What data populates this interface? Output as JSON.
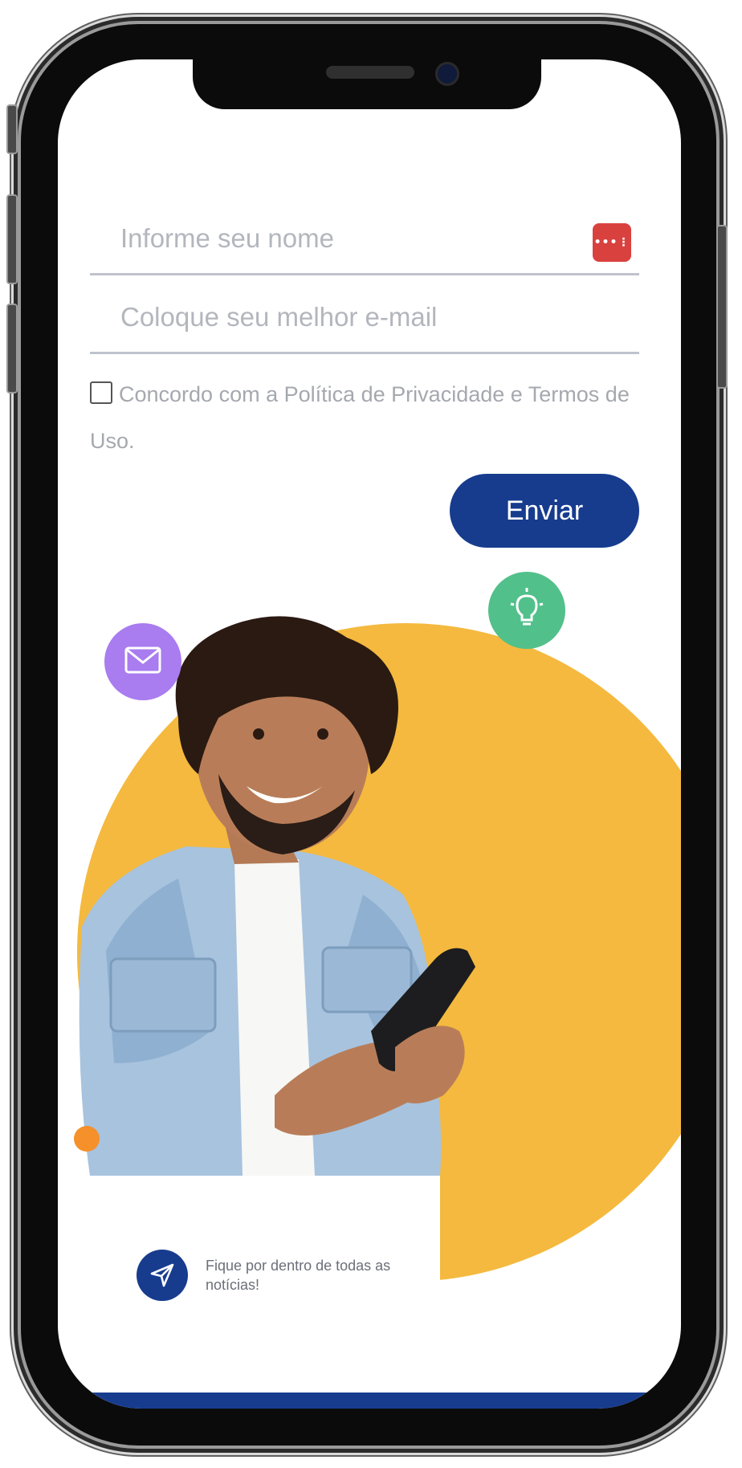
{
  "form": {
    "name_placeholder": "Informe seu nome",
    "email_placeholder": "Coloque seu melhor e-mail",
    "consent_text": "Concordo com a Política de Privacidade e Termos de Uso.",
    "consent_checked": false,
    "submit_label": "Enviar"
  },
  "icons": {
    "password_manager": "password-manager-icon",
    "mail": "mail-icon",
    "lightbulb": "lightbulb-icon",
    "send": "send-icon"
  },
  "news_card": {
    "text": "Fique por dentro de todas as notícias!"
  },
  "colors": {
    "brand_blue": "#173c8e",
    "yellow": "#f4b93e",
    "purple": "#a97cf0",
    "green": "#52c08a",
    "orange": "#f5902b",
    "password_red": "#d9413f"
  }
}
